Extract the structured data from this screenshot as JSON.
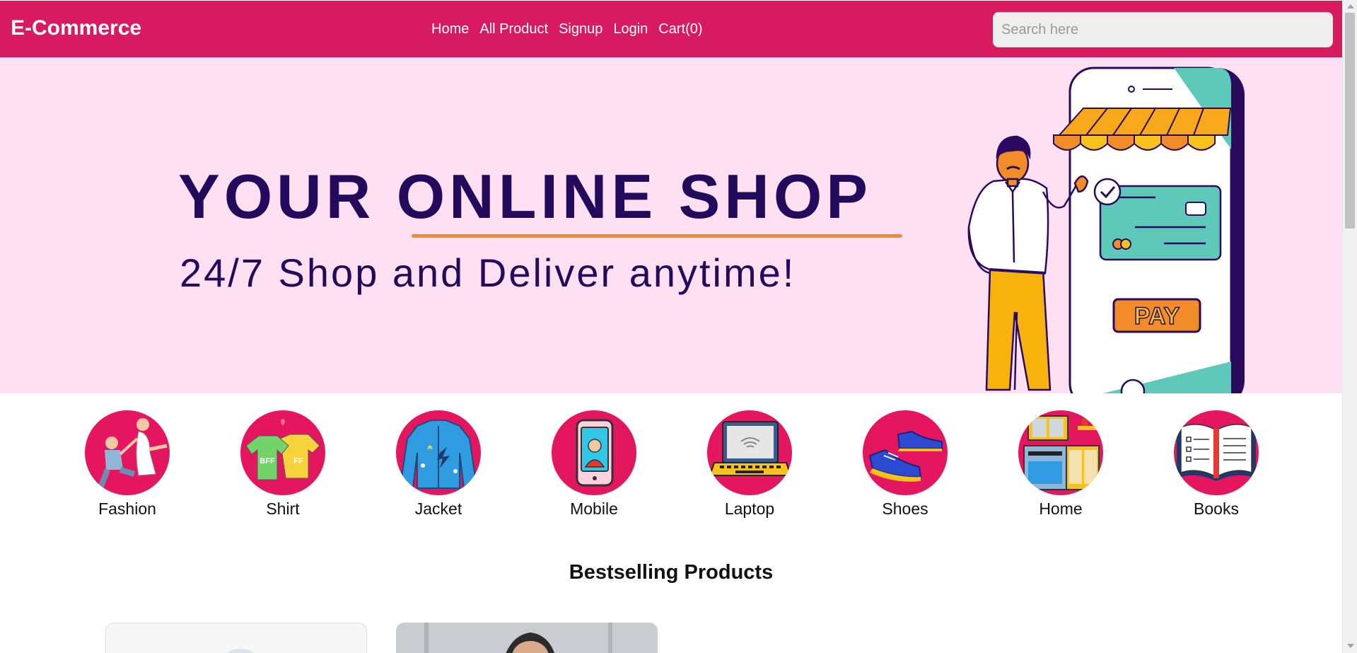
{
  "navbar": {
    "brand": "E-Commerce",
    "links": [
      "Home",
      "All Product",
      "Signup",
      "Login",
      "Cart(0)"
    ],
    "search_placeholder": "Search here",
    "bg_color": "#d81b60"
  },
  "hero": {
    "title": "YOUR ONLINE SHOP",
    "subtitle": "24/7 Shop and Deliver anytime!",
    "pay_label": "PAY",
    "bg_color": "#ffe0f3",
    "text_color": "#220a5c",
    "accent_color": "#f28c28"
  },
  "categories": [
    {
      "label": "Fashion",
      "icon": "couple-proposal-icon"
    },
    {
      "label": "Shirt",
      "icon": "bff-tshirts-icon"
    },
    {
      "label": "Jacket",
      "icon": "jacket-icon"
    },
    {
      "label": "Mobile",
      "icon": "mobile-phone-icon"
    },
    {
      "label": "Laptop",
      "icon": "laptop-icon"
    },
    {
      "label": "Shoes",
      "icon": "shoes-icon"
    },
    {
      "label": "Home",
      "icon": "home-furniture-icon"
    },
    {
      "label": "Books",
      "icon": "open-book-icon"
    }
  ],
  "bestselling": {
    "title": "Bestselling Products"
  }
}
